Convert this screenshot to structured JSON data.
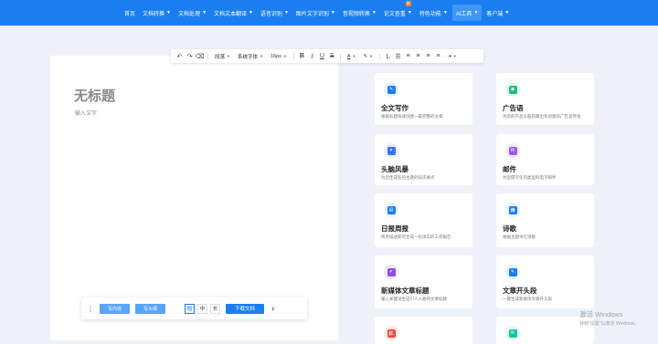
{
  "nav": {
    "items": [
      {
        "label": "首页",
        "caret": false,
        "active": false,
        "badge": ""
      },
      {
        "label": "文档转换",
        "caret": true,
        "active": false,
        "badge": ""
      },
      {
        "label": "文档处理",
        "caret": true,
        "active": false,
        "badge": ""
      },
      {
        "label": "文档文本翻译",
        "caret": true,
        "active": false,
        "badge": ""
      },
      {
        "label": "语音识别",
        "caret": true,
        "active": false,
        "badge": ""
      },
      {
        "label": "图片文字识别",
        "caret": true,
        "active": false,
        "badge": ""
      },
      {
        "label": "音视频转换",
        "caret": true,
        "active": false,
        "badge": ""
      },
      {
        "label": "论文查重",
        "caret": true,
        "active": false,
        "badge": "新"
      },
      {
        "label": "特色功能",
        "caret": true,
        "active": false,
        "badge": ""
      },
      {
        "label": "AI工具",
        "caret": true,
        "active": true,
        "badge": ""
      },
      {
        "label": "客户端",
        "caret": true,
        "active": false,
        "badge": ""
      }
    ],
    "caret_glyph": "▼"
  },
  "toolbar": {
    "undo": "↶",
    "redo": "↷",
    "clear_format": "⌫",
    "paragraph_label": "段落",
    "font_label": "系统字体",
    "size_label": "16px",
    "bold": "B",
    "italic": "I",
    "underline": "U",
    "strike": "S",
    "font_color": "A",
    "highlight": "✎",
    "list_ordered": "⒈",
    "list_bullet": "☰",
    "align_left": "≡",
    "align_center": "≡",
    "align_right": "≡",
    "align_justify": "≡",
    "indent": "⇥",
    "caret": "▼"
  },
  "doc": {
    "title": "无标题",
    "placeholder": "输入文字"
  },
  "actionbar": {
    "more": "⋮",
    "continue_label": "写内容",
    "expand_label": "写大纲",
    "sizes": [
      {
        "label": "短",
        "active": true
      },
      {
        "label": "中",
        "active": false
      },
      {
        "label": "长",
        "active": false
      }
    ],
    "download_label": "下载文档",
    "next": "›"
  },
  "tools": [
    {
      "title": "全文写作",
      "desc": "根据标题快速创建一篇完整的文章",
      "color": "#1a7ef0",
      "bg": "#e6f1fe",
      "icon": "document-edit-icon",
      "glyph": "✎"
    },
    {
      "title": "广告语",
      "desc": "为您的产品头脑风暴出有创意的广告宣传语",
      "color": "#1fbf7a",
      "bg": "#e3f8ee",
      "icon": "megaphone-icon",
      "glyph": "◉"
    },
    {
      "title": "头脑风暴",
      "desc": "为您生成任何主题的知识要点",
      "color": "#3b6ff5",
      "bg": "#e8eefe",
      "icon": "lightbulb-icon",
      "glyph": "✦"
    },
    {
      "title": "邮件",
      "desc": "为您撰写任何类型的电子邮件",
      "color": "#9b5de5",
      "bg": "#f1e9fc",
      "icon": "mail-icon",
      "glyph": "✉"
    },
    {
      "title": "日报周报",
      "desc": "简单描述即可生成一份详实的工作报告",
      "color": "#1a7ef0",
      "bg": "#e6f1fe",
      "icon": "report-icon",
      "glyph": "▤"
    },
    {
      "title": "诗歌",
      "desc": "根据主题书写诗歌",
      "color": "#1a7ef0",
      "bg": "#e6f1fe",
      "icon": "poem-icon",
      "glyph": "诗"
    },
    {
      "title": "新媒体文章标题",
      "desc": "输入关键词生成引人入胜的文章标题",
      "color": "#8a4fe6",
      "bg": "#efe6fd",
      "icon": "pen-title-icon",
      "glyph": "✐"
    },
    {
      "title": "文章开头段",
      "desc": "一键生成新媒体文章开头段",
      "color": "#1a7ef0",
      "bg": "#e6f1fe",
      "icon": "paragraph-icon",
      "glyph": "✎"
    },
    {
      "title": "",
      "desc": "",
      "color": "#f0443a",
      "bg": "#fde7e6",
      "icon": "red-book-icon",
      "glyph": "红"
    },
    {
      "title": "",
      "desc": "",
      "color": "#18c29c",
      "bg": "#e0f8f2",
      "icon": "chat-bubble-icon",
      "glyph": "✉"
    }
  ],
  "watermark": {
    "line1": "激活 Windows",
    "line2": "转到\"设置\"以激活 Windows。"
  }
}
